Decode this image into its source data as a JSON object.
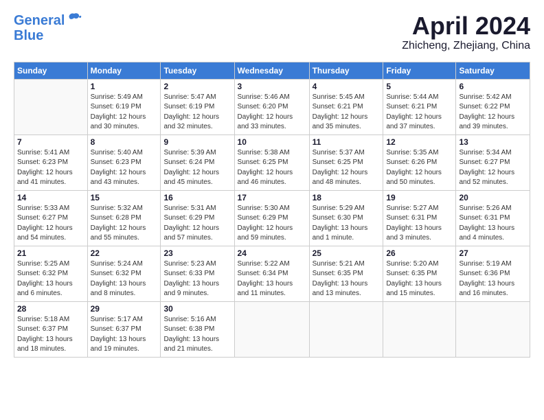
{
  "header": {
    "logo_general": "General",
    "logo_blue": "Blue",
    "title": "April 2024",
    "subtitle": "Zhicheng, Zhejiang, China"
  },
  "weekdays": [
    "Sunday",
    "Monday",
    "Tuesday",
    "Wednesday",
    "Thursday",
    "Friday",
    "Saturday"
  ],
  "weeks": [
    [
      {
        "day": "",
        "info": ""
      },
      {
        "day": "1",
        "info": "Sunrise: 5:49 AM\nSunset: 6:19 PM\nDaylight: 12 hours\nand 30 minutes."
      },
      {
        "day": "2",
        "info": "Sunrise: 5:47 AM\nSunset: 6:19 PM\nDaylight: 12 hours\nand 32 minutes."
      },
      {
        "day": "3",
        "info": "Sunrise: 5:46 AM\nSunset: 6:20 PM\nDaylight: 12 hours\nand 33 minutes."
      },
      {
        "day": "4",
        "info": "Sunrise: 5:45 AM\nSunset: 6:21 PM\nDaylight: 12 hours\nand 35 minutes."
      },
      {
        "day": "5",
        "info": "Sunrise: 5:44 AM\nSunset: 6:21 PM\nDaylight: 12 hours\nand 37 minutes."
      },
      {
        "day": "6",
        "info": "Sunrise: 5:42 AM\nSunset: 6:22 PM\nDaylight: 12 hours\nand 39 minutes."
      }
    ],
    [
      {
        "day": "7",
        "info": "Sunrise: 5:41 AM\nSunset: 6:23 PM\nDaylight: 12 hours\nand 41 minutes."
      },
      {
        "day": "8",
        "info": "Sunrise: 5:40 AM\nSunset: 6:23 PM\nDaylight: 12 hours\nand 43 minutes."
      },
      {
        "day": "9",
        "info": "Sunrise: 5:39 AM\nSunset: 6:24 PM\nDaylight: 12 hours\nand 45 minutes."
      },
      {
        "day": "10",
        "info": "Sunrise: 5:38 AM\nSunset: 6:25 PM\nDaylight: 12 hours\nand 46 minutes."
      },
      {
        "day": "11",
        "info": "Sunrise: 5:37 AM\nSunset: 6:25 PM\nDaylight: 12 hours\nand 48 minutes."
      },
      {
        "day": "12",
        "info": "Sunrise: 5:35 AM\nSunset: 6:26 PM\nDaylight: 12 hours\nand 50 minutes."
      },
      {
        "day": "13",
        "info": "Sunrise: 5:34 AM\nSunset: 6:27 PM\nDaylight: 12 hours\nand 52 minutes."
      }
    ],
    [
      {
        "day": "14",
        "info": "Sunrise: 5:33 AM\nSunset: 6:27 PM\nDaylight: 12 hours\nand 54 minutes."
      },
      {
        "day": "15",
        "info": "Sunrise: 5:32 AM\nSunset: 6:28 PM\nDaylight: 12 hours\nand 55 minutes."
      },
      {
        "day": "16",
        "info": "Sunrise: 5:31 AM\nSunset: 6:29 PM\nDaylight: 12 hours\nand 57 minutes."
      },
      {
        "day": "17",
        "info": "Sunrise: 5:30 AM\nSunset: 6:29 PM\nDaylight: 12 hours\nand 59 minutes."
      },
      {
        "day": "18",
        "info": "Sunrise: 5:29 AM\nSunset: 6:30 PM\nDaylight: 13 hours\nand 1 minute."
      },
      {
        "day": "19",
        "info": "Sunrise: 5:27 AM\nSunset: 6:31 PM\nDaylight: 13 hours\nand 3 minutes."
      },
      {
        "day": "20",
        "info": "Sunrise: 5:26 AM\nSunset: 6:31 PM\nDaylight: 13 hours\nand 4 minutes."
      }
    ],
    [
      {
        "day": "21",
        "info": "Sunrise: 5:25 AM\nSunset: 6:32 PM\nDaylight: 13 hours\nand 6 minutes."
      },
      {
        "day": "22",
        "info": "Sunrise: 5:24 AM\nSunset: 6:32 PM\nDaylight: 13 hours\nand 8 minutes."
      },
      {
        "day": "23",
        "info": "Sunrise: 5:23 AM\nSunset: 6:33 PM\nDaylight: 13 hours\nand 9 minutes."
      },
      {
        "day": "24",
        "info": "Sunrise: 5:22 AM\nSunset: 6:34 PM\nDaylight: 13 hours\nand 11 minutes."
      },
      {
        "day": "25",
        "info": "Sunrise: 5:21 AM\nSunset: 6:35 PM\nDaylight: 13 hours\nand 13 minutes."
      },
      {
        "day": "26",
        "info": "Sunrise: 5:20 AM\nSunset: 6:35 PM\nDaylight: 13 hours\nand 15 minutes."
      },
      {
        "day": "27",
        "info": "Sunrise: 5:19 AM\nSunset: 6:36 PM\nDaylight: 13 hours\nand 16 minutes."
      }
    ],
    [
      {
        "day": "28",
        "info": "Sunrise: 5:18 AM\nSunset: 6:37 PM\nDaylight: 13 hours\nand 18 minutes."
      },
      {
        "day": "29",
        "info": "Sunrise: 5:17 AM\nSunset: 6:37 PM\nDaylight: 13 hours\nand 19 minutes."
      },
      {
        "day": "30",
        "info": "Sunrise: 5:16 AM\nSunset: 6:38 PM\nDaylight: 13 hours\nand 21 minutes."
      },
      {
        "day": "",
        "info": ""
      },
      {
        "day": "",
        "info": ""
      },
      {
        "day": "",
        "info": ""
      },
      {
        "day": "",
        "info": ""
      }
    ]
  ]
}
